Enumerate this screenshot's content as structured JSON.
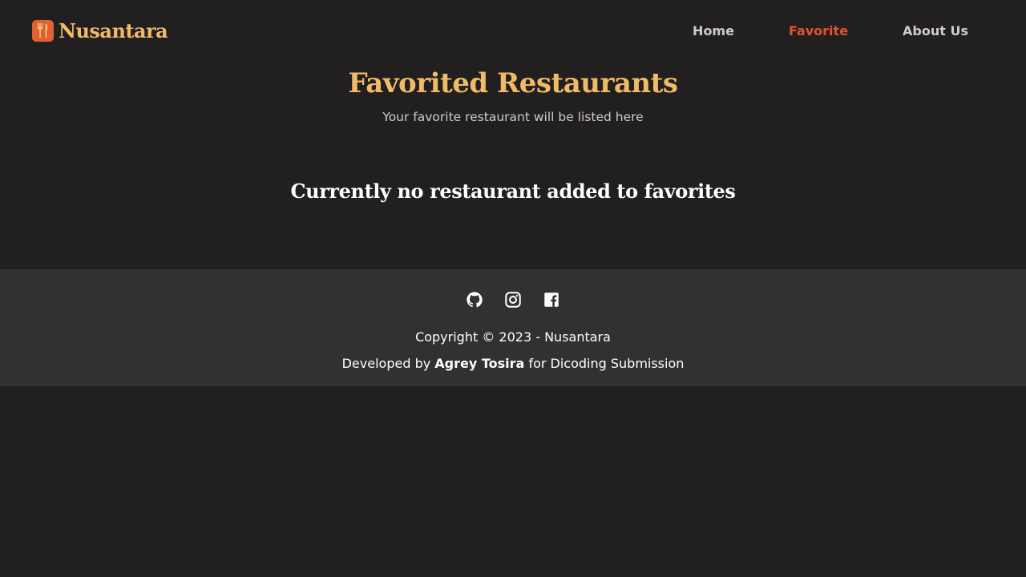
{
  "navbar": {
    "brand": "Nusantara",
    "brand_icon": "fork-knife-icon",
    "links": [
      {
        "label": "Home",
        "active": false
      },
      {
        "label": "Favorite",
        "active": true
      },
      {
        "label": "About Us",
        "active": false
      }
    ]
  },
  "hero": {
    "title": "Favorited Restaurants",
    "subtitle": "Your favorite restaurant will be listed here"
  },
  "main": {
    "empty_message": "Currently no restaurant added to favorites"
  },
  "footer": {
    "socials": [
      "github-icon",
      "instagram-icon",
      "facebook-icon"
    ],
    "copyright": "Copyright © 2023 - Nusantara",
    "developed_prefix": "Developed by",
    "developer": "Agrey Tosira",
    "developed_suffix": "for Dicoding Submission"
  },
  "colors": {
    "background": "#211f20",
    "footer_background": "#323031",
    "accent_gold": "#f0bb66",
    "accent_orange": "#e0542e"
  }
}
